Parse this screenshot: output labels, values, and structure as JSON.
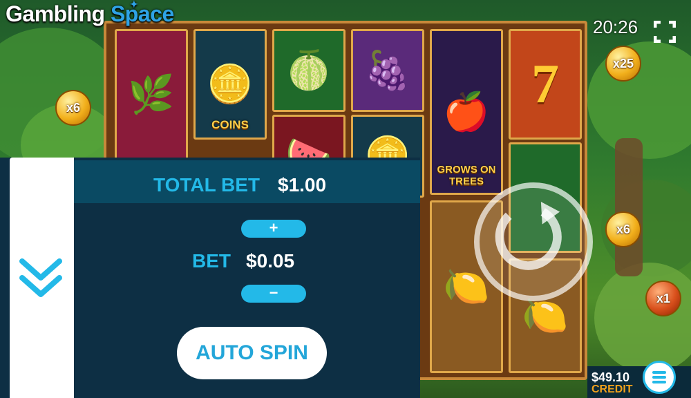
{
  "brand": {
    "part1": "Gambling",
    "part2": "Space"
  },
  "clock": "20:26",
  "total_bet": {
    "label": "TOTAL BET",
    "value": "$1.00"
  },
  "bet": {
    "label": "BET",
    "value": "$0.05",
    "plus": "+",
    "minus": "−"
  },
  "auto_spin": "AUTO SPIN",
  "credit": {
    "value": "$49.10",
    "label": "CREDIT"
  },
  "multipliers": [
    "x6",
    "x25",
    "x6",
    "x1"
  ],
  "reels": [
    {
      "name": "beanstalk-symbol",
      "glyph": "🌿",
      "text": ""
    },
    {
      "name": "coins-symbol",
      "glyph": "🪙",
      "text": "COINS"
    },
    {
      "name": "lime-symbol",
      "glyph": "🍈",
      "text": ""
    },
    {
      "name": "grapes-symbol",
      "glyph": "🍇",
      "text": ""
    },
    {
      "name": "grows-on-trees-symbol",
      "glyph": "🍎",
      "text": "GROWS ON TREES"
    },
    {
      "name": "seven-symbol",
      "glyph": "7",
      "text": ""
    },
    {
      "name": "watermelon-symbol",
      "glyph": "🍉",
      "text": ""
    },
    {
      "name": "coins-symbol-2",
      "glyph": "🪙",
      "text": ""
    },
    {
      "name": "lemon-symbol",
      "glyph": "🍋",
      "text": ""
    },
    {
      "name": "lemon-symbol-2",
      "glyph": "🍋",
      "text": ""
    }
  ],
  "colors": {
    "accent": "#23b9e8",
    "credit_label": "#f2a21c",
    "panel": "#0d2f44"
  }
}
